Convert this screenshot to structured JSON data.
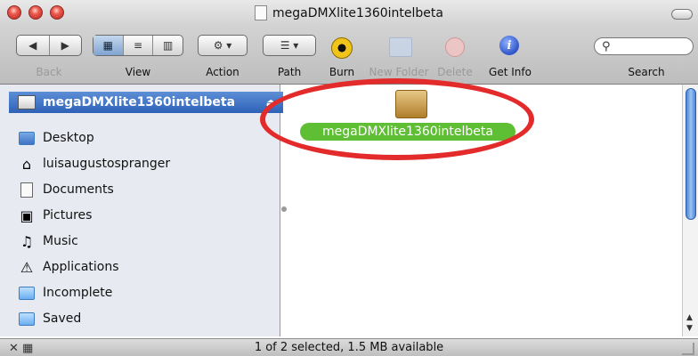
{
  "window": {
    "title": "megaDMXlite1360intelbeta"
  },
  "toolbar": {
    "back_label": "Back",
    "view_label": "View",
    "action_label": "Action",
    "path_label": "Path",
    "burn_label": "Burn",
    "new_folder_label": "New Folder",
    "delete_label": "Delete",
    "get_info_label": "Get Info",
    "search_label": "Search",
    "search_placeholder": ""
  },
  "sidebar": {
    "volume": "megaDMXlite1360intelbeta",
    "items": [
      {
        "label": "Desktop",
        "icon": "desktop-icon"
      },
      {
        "label": "luisaugustospranger",
        "icon": "home-icon"
      },
      {
        "label": "Documents",
        "icon": "documents-icon"
      },
      {
        "label": "Pictures",
        "icon": "pictures-icon"
      },
      {
        "label": "Music",
        "icon": "music-icon"
      },
      {
        "label": "Applications",
        "icon": "applications-icon"
      },
      {
        "label": "Incomplete",
        "icon": "folder-icon"
      },
      {
        "label": "Saved",
        "icon": "folder-icon"
      }
    ]
  },
  "content": {
    "file": {
      "name": "megaDMXlite1360intelbeta",
      "icon": "package-icon",
      "selected": true
    }
  },
  "statusbar": {
    "text": "1 of 2 selected, 1.5 MB available"
  },
  "colors": {
    "selection": "#5fbf34",
    "annotation": "#e32b2b",
    "sidebar_selected": "#2e62b8"
  }
}
